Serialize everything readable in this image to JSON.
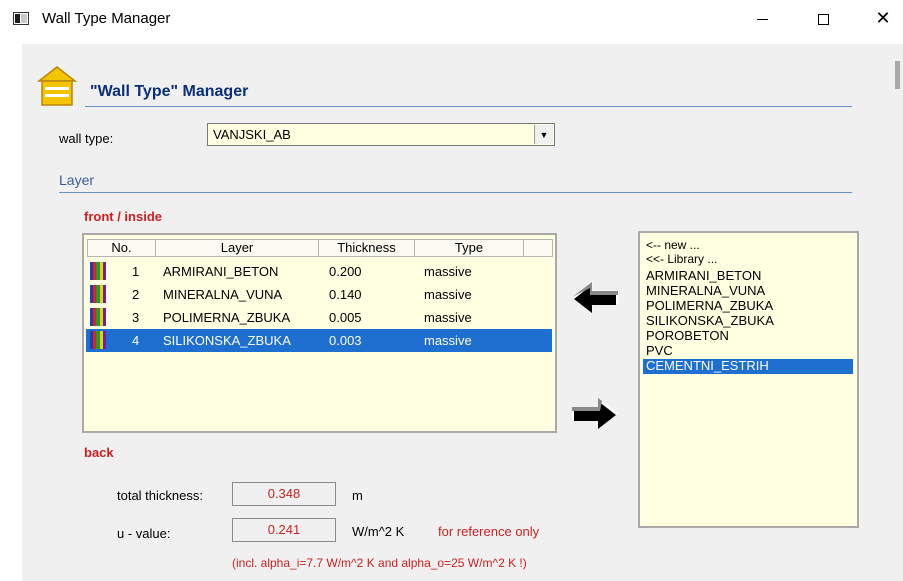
{
  "window": {
    "title": "Wall Type Manager",
    "minimize": "—",
    "maximize": "□",
    "close": "✕"
  },
  "header": {
    "title": "\"Wall Type\" Manager",
    "icon": "house-icon"
  },
  "wall_type": {
    "label": "wall type:",
    "value": "VANJSKI_AB"
  },
  "layer_section": {
    "label": "Layer",
    "front_label": "front / inside",
    "back_label": "back"
  },
  "layer_table": {
    "columns": [
      "No.",
      "Layer",
      "Thickness",
      "Type"
    ],
    "rows": [
      {
        "no": "1",
        "layer": "ARMIRANI_BETON",
        "thickness": "0.200",
        "type": "massive",
        "selected": false
      },
      {
        "no": "2",
        "layer": "MINERALNA_VUNA",
        "thickness": "0.140",
        "type": "massive",
        "selected": false
      },
      {
        "no": "3",
        "layer": "POLIMERNA_ZBUKA",
        "thickness": "0.005",
        "type": "massive",
        "selected": false
      },
      {
        "no": "4",
        "layer": "SILIKONSKA_ZBUKA",
        "thickness": "0.003",
        "type": "massive",
        "selected": true
      }
    ]
  },
  "library": {
    "items": [
      {
        "label": "<-- new ...",
        "selected": false
      },
      {
        "label": "<<- Library ...",
        "selected": false
      },
      {
        "label": "ARMIRANI_BETON",
        "selected": false
      },
      {
        "label": "MINERALNA_VUNA",
        "selected": false
      },
      {
        "label": "POLIMERNA_ZBUKA",
        "selected": false
      },
      {
        "label": "SILIKONSKA_ZBUKA",
        "selected": false
      },
      {
        "label": "POROBETON",
        "selected": false
      },
      {
        "label": "PVC",
        "selected": false
      },
      {
        "label": "CEMENTNI_ESTRIH",
        "selected": true
      }
    ]
  },
  "totals": {
    "thickness_label": "total thickness:",
    "thickness_value": "0.348",
    "thickness_unit": "m",
    "u_label": "u - value:",
    "u_value": "0.241",
    "u_unit": "W/m^2 K",
    "reference_note": "for reference only",
    "incl_note": "(incl. alpha_i=7.7 W/m^2 K and alpha_o=25 W/m^2 K !)"
  },
  "colors": {
    "accent_red": "#cc1f1f",
    "selection_blue": "#1f6fd1",
    "list_background": "#ffffe2",
    "title_navy": "#0b2f7a"
  }
}
